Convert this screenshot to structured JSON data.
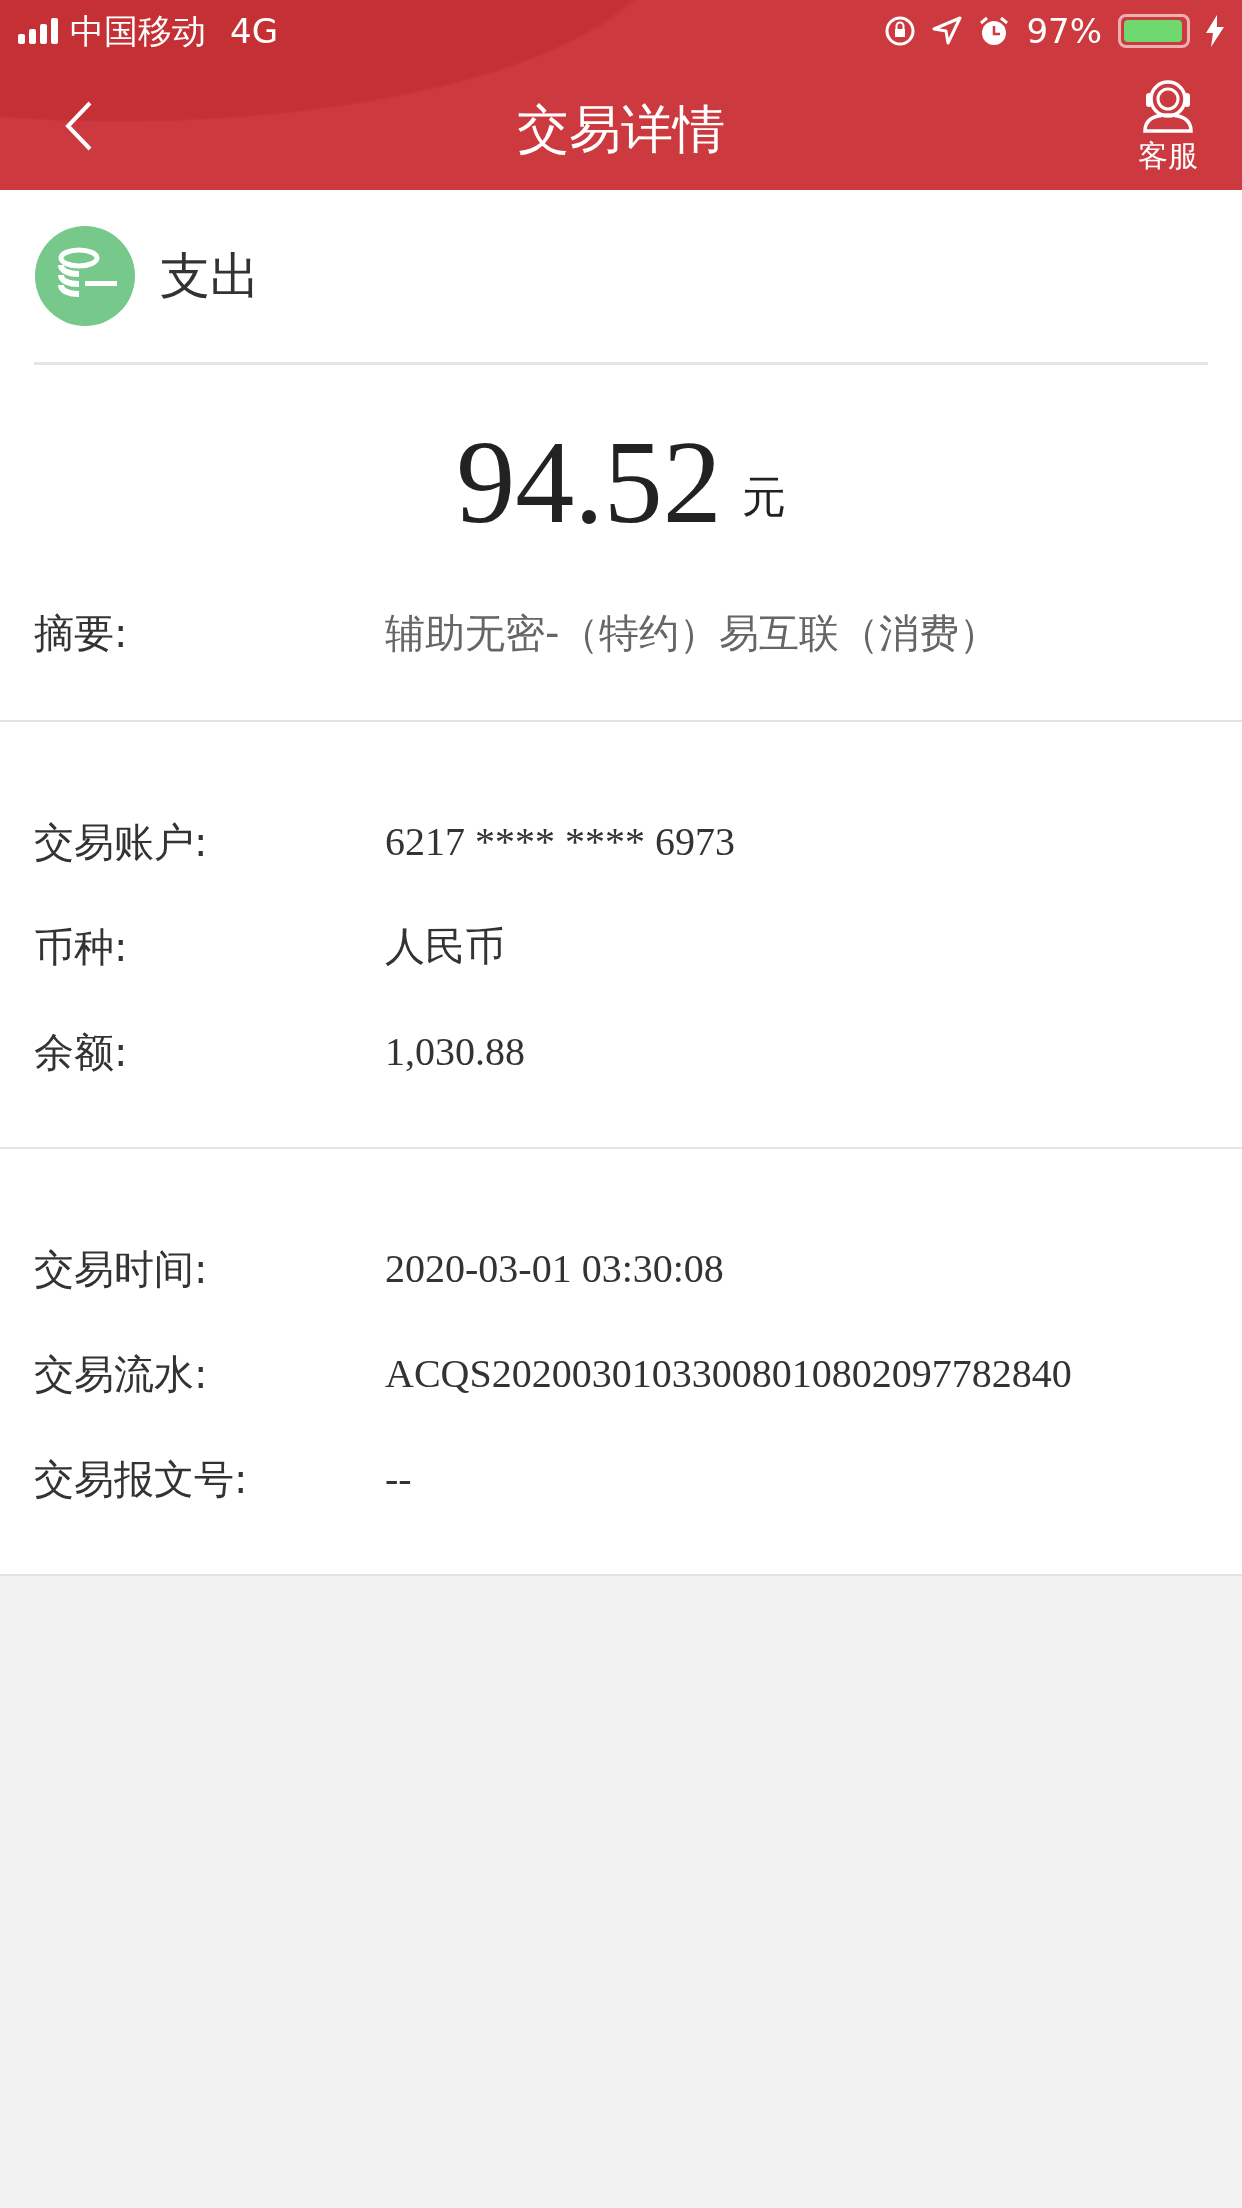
{
  "status_bar": {
    "carrier": "中国移动",
    "network": "4G",
    "battery": "97%"
  },
  "nav": {
    "title": "交易详情",
    "service_label": "客服"
  },
  "type": {
    "label": "支出"
  },
  "amount": {
    "value": "94.52",
    "unit": "元"
  },
  "summary": {
    "label": "摘要:",
    "value": "辅助无密-（特约）易互联（消费）"
  },
  "groups": [
    [
      {
        "label": "交易账户:",
        "value": "6217 **** **** 6973"
      },
      {
        "label": "币种:",
        "value": "人民币"
      },
      {
        "label": "余额:",
        "value": "1,030.88"
      }
    ],
    [
      {
        "label": "交易时间:",
        "value": "2020-03-01 03:30:08"
      },
      {
        "label": "交易流水:",
        "value": "ACQS20200301033008010802097782840"
      },
      {
        "label": "交易报文号:",
        "value": "--"
      }
    ]
  ]
}
